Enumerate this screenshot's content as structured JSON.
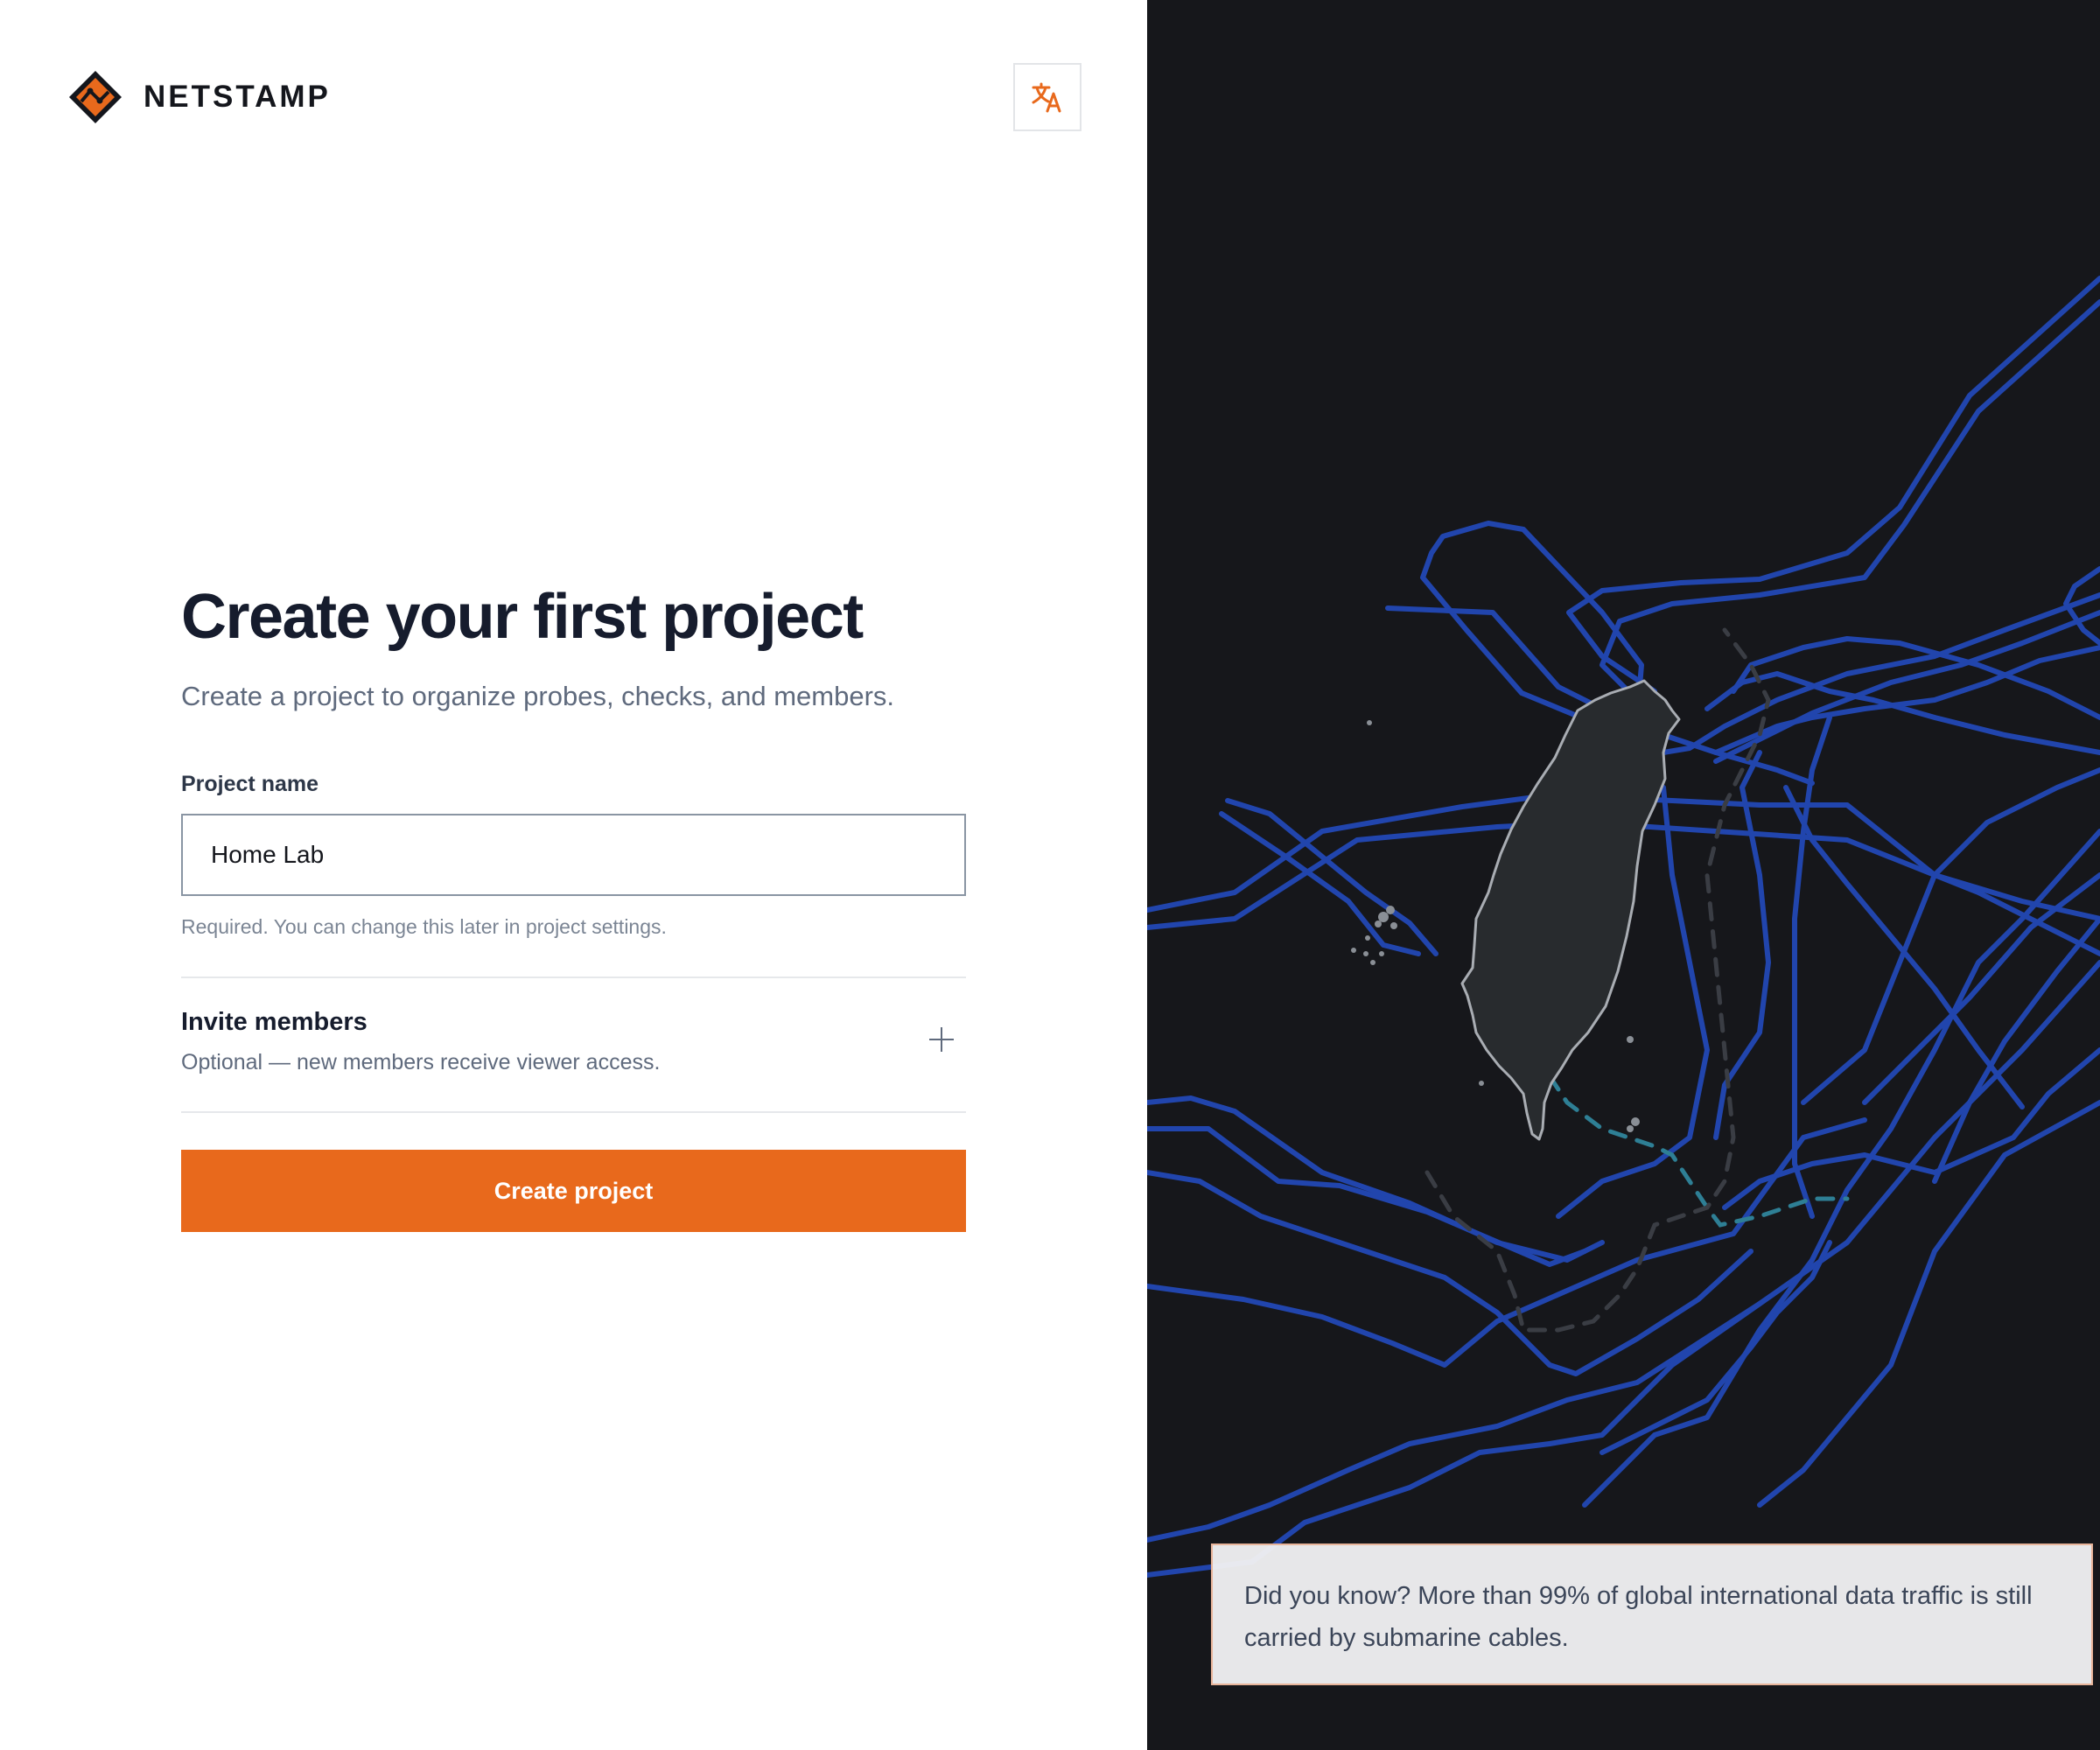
{
  "brand": {
    "name": "NETSTAMP",
    "logo_icon": "network-diamond-icon",
    "accent_color": "#e8691c"
  },
  "language_button": {
    "icon": "translate-icon"
  },
  "form": {
    "title": "Create your first project",
    "subtitle": "Create a project to organize probes, checks, and members.",
    "project_name_label": "Project name",
    "project_name_value": "Home Lab",
    "project_name_helper": "Required. You can change this later in project settings.",
    "invite_title": "Invite members",
    "invite_description": "Optional — new members receive viewer access.",
    "invite_icon": "plus-icon",
    "submit_label": "Create project"
  },
  "side_panel": {
    "map_description_icon": "submarine-cable-map",
    "background_color": "#16171b",
    "cable_color": "#2248b5",
    "fact": "Did you know? More than 99% of global international data traffic is still carried by submarine cables."
  }
}
